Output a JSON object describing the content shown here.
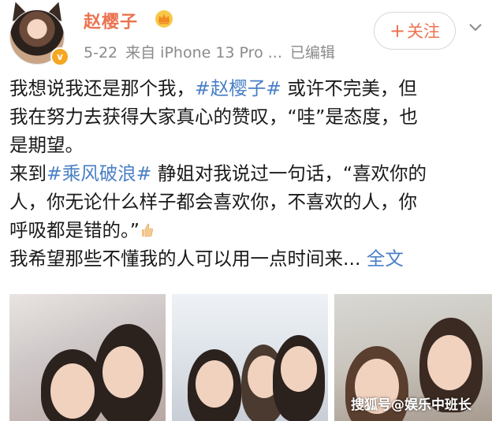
{
  "header": {
    "username": "赵樱子",
    "date": "5-22",
    "source": "来自 iPhone 13 Pro ...",
    "edited": "已编辑",
    "follow_label": "关注",
    "follow_plus": "+"
  },
  "post": {
    "line1_a": "我想说我还是那个我，",
    "line1_tag": "#赵樱子#",
    "line1_b": " 或许不完美，但",
    "line2": "我在努力去获得大家真心的赞叹，“哇”是态度，也",
    "line3": "是期望。",
    "line4_a": "来到",
    "line4_tag": "#乘风破浪#",
    "line4_b": " 静姐对我说过一句话，“喜欢你的",
    "line5": "人，你无论什么样子都会喜欢你，不喜欢的人，你",
    "line6": "呼吸都是错的。”",
    "line7": "我希望那些不懂我的人可以用一点时间来... ",
    "full_text_link": "全文"
  },
  "watermark": "搜狐号@娱乐中班长",
  "colors": {
    "username": "#eb7350",
    "hashtag": "#4a7fc6",
    "meta": "#8a8a8a"
  },
  "icons": [
    "crown-icon",
    "chevron-down-icon",
    "thumbs-up-icon",
    "vip-badge"
  ]
}
